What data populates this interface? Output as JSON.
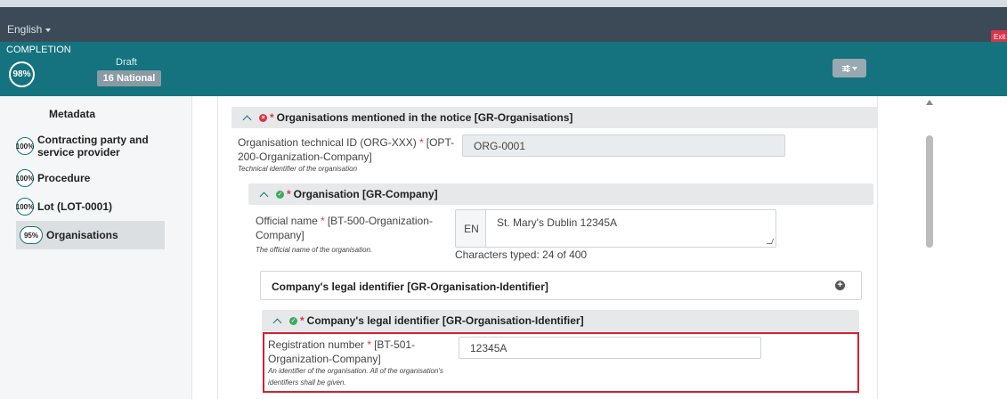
{
  "topbar": {
    "language": "English",
    "exit_label": "Exit"
  },
  "status": {
    "completion_label": "COMPLETION",
    "completion_percent": "98%",
    "draft_label": "Draft",
    "notice_type_badge": "16 National"
  },
  "sidebar": {
    "metadata_label": "Metadata",
    "items": [
      {
        "percent": "100%",
        "label": "Contracting party and service provider"
      },
      {
        "percent": "100%",
        "label": "Procedure"
      },
      {
        "percent": "100%",
        "label": "Lot (LOT-0001)"
      },
      {
        "percent": "95%",
        "label": "Organisations"
      }
    ]
  },
  "form": {
    "organisations_section": {
      "title": "Organisations mentioned in the notice  [GR-Organisations]"
    },
    "org_id": {
      "label": "Organisation technical ID (ORG-XXX)",
      "label_suffix": "[OPT-200-Organization-Company]",
      "hint": "Technical identifier of the organisation",
      "value": "ORG-0001"
    },
    "organisation_section": {
      "title": "Organisation  [GR-Company]"
    },
    "official_name": {
      "label": "Official name",
      "label_suffix": "[BT-500-Organization-Company]",
      "hint": "The official name of the organisation.",
      "lang": "EN",
      "value": "St. Mary's Dublin 12345A",
      "chars_typed": "Characters typed: 24 of 400"
    },
    "legal_id_collapsed": {
      "title": "Company's legal identifier  [GR-Organisation-Identifier]"
    },
    "legal_id_section": {
      "title": "Company's legal identifier  [GR-Organisation-Identifier]"
    },
    "registration_number": {
      "label": "Registration number",
      "label_suffix": "[BT-501-Organization-Company]",
      "hint": "An identifier of the organisation. All of the organisation's identifiers shall be given.",
      "value": "12345A"
    }
  },
  "colors": {
    "accent": "#14737e",
    "topbar": "#3c4a57",
    "error": "#d9334a",
    "ok": "#3eaa5b",
    "highlight": "#d41f2e"
  }
}
